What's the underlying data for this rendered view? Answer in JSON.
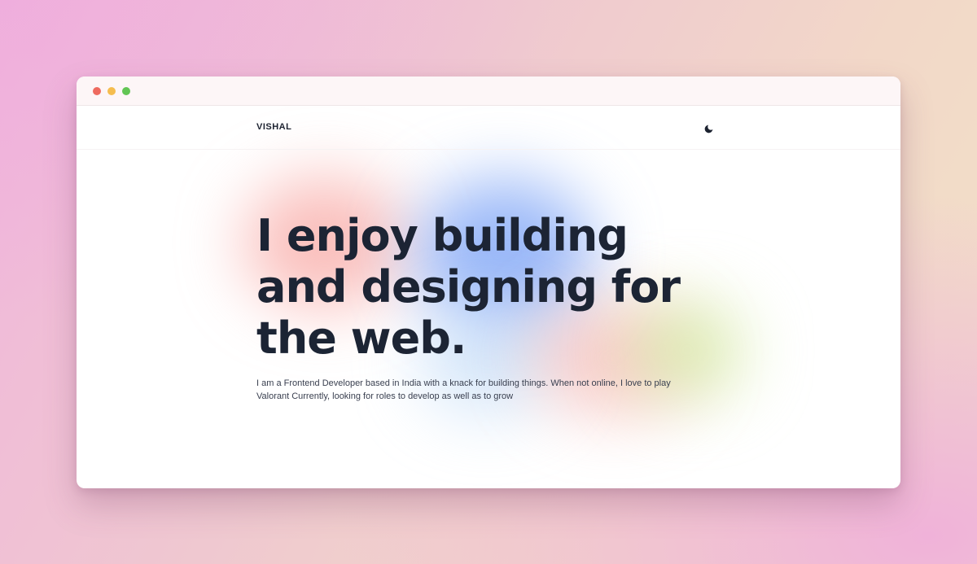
{
  "window": {
    "controls": [
      "close",
      "minimize",
      "maximize"
    ],
    "colors": {
      "close": "#ee6a5f",
      "minimize": "#f5bd4f",
      "maximize": "#62c554"
    }
  },
  "nav": {
    "logo": "VISHAL",
    "theme_toggle_icon": "moon-icon"
  },
  "hero": {
    "title_lines": [
      "I enjoy building",
      "and designing for",
      "the web."
    ],
    "description_lines": [
      "I am a Frontend Developer based in India with a knack for building things. When not online, I love to play",
      "Valorant Currently, looking for roles to develop as well as to grow"
    ]
  },
  "colors": {
    "heading": "#1c2434",
    "body_text": "#3a4050",
    "background_gradient": [
      "#f1b5dc",
      "#f2d8c8",
      "#f1e2c8"
    ]
  }
}
